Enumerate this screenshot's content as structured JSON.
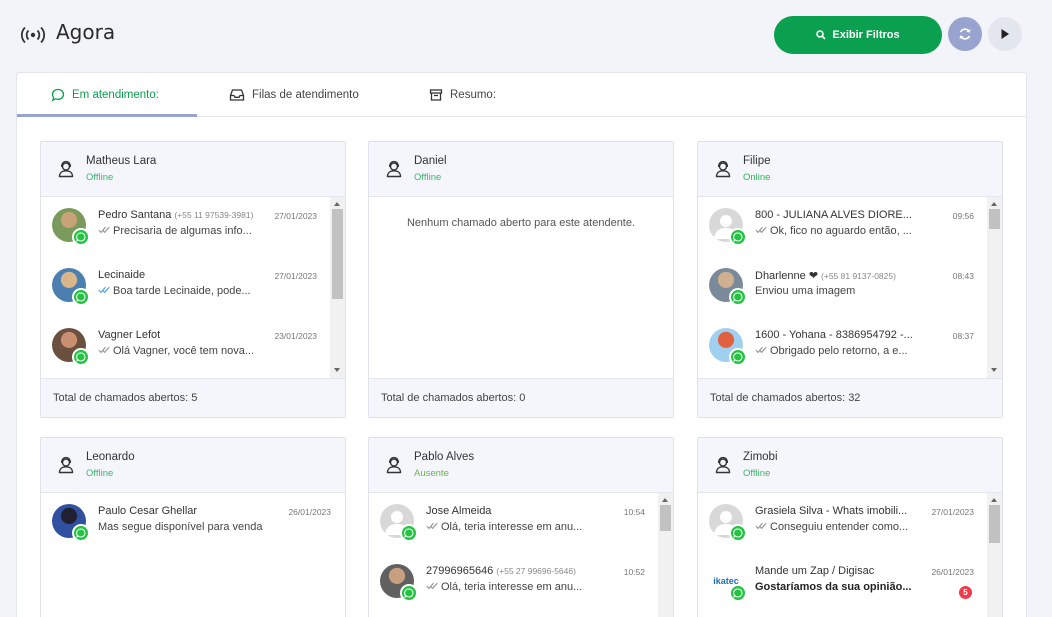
{
  "header": {
    "title": "Agora",
    "filter_button": "Exibir Filtros"
  },
  "tabs": [
    {
      "label": "Em atendimento:"
    },
    {
      "label": "Filas de atendimento"
    },
    {
      "label": "Resumo:"
    }
  ],
  "colors": {
    "accent": "#0aa04f",
    "offline": "#3eb36b",
    "online": "#2fb25a",
    "away": "#6ab04c",
    "whatsapp": "#25c343",
    "unread": "#ef3b4c"
  },
  "agents": [
    {
      "name": "Matheus Lara",
      "status": "Offline",
      "total": "Total de chamados abertos: 5",
      "chats": [
        {
          "name": "Pedro Santana",
          "phone": "(+55 11 97539-3981)",
          "date": "27/01/2023",
          "message": "Precisaria de algumas info...",
          "check": "grey",
          "avatar": "photo"
        },
        {
          "name": "Lecinaide",
          "phone": "",
          "date": "27/01/2023",
          "message": "Boa tarde Lecinaide, pode...",
          "check": "blue",
          "avatar": "photo"
        },
        {
          "name": "Vagner Lefot",
          "phone": "",
          "date": "23/01/2023",
          "message": "Olá Vagner, você tem nova...",
          "check": "grey",
          "avatar": "photo"
        }
      ]
    },
    {
      "name": "Daniel",
      "status": "Offline",
      "total": "Total de chamados abertos: 0",
      "empty": "Nenhum chamado aberto para este atendente.",
      "chats": []
    },
    {
      "name": "Filipe",
      "status": "Online",
      "total": "Total de chamados abertos: 32",
      "chats": [
        {
          "name": "800 - JULIANA ALVES DIORE...",
          "phone": "",
          "date": "09:56",
          "message": "Ok, fico no aguardo então, ...",
          "check": "grey",
          "avatar": "default"
        },
        {
          "name": "Dharlenne ❤",
          "phone": "(+55 81 9137-0825)",
          "date": "08:43",
          "message": "Enviou uma imagem",
          "check": "",
          "avatar": "photo"
        },
        {
          "name": "1600 - Yohana - 8386954792 -...",
          "phone": "",
          "date": "08:37",
          "message": "Obrigado pelo retorno, a e...",
          "check": "grey",
          "avatar": "photo"
        }
      ]
    },
    {
      "name": "Leonardo",
      "status": "Offline",
      "total": "",
      "chats": [
        {
          "name": "Paulo Cesar Ghellar",
          "phone": "",
          "date": "26/01/2023",
          "message": "Mas segue disponível para venda",
          "check": "",
          "avatar": "photo"
        }
      ]
    },
    {
      "name": "Pablo Alves",
      "status": "Ausente",
      "total": "",
      "chats": [
        {
          "name": "Jose Almeida",
          "phone": "",
          "date": "10:54",
          "message": "Olá, teria interesse em anu...",
          "check": "grey",
          "avatar": "default"
        },
        {
          "name": "27996965646",
          "phone": "(+55 27 99696-5646)",
          "date": "10:52",
          "message": "Olá, teria interesse em anu...",
          "check": "grey",
          "avatar": "photo"
        }
      ]
    },
    {
      "name": "Zimobi",
      "status": "Offline",
      "total": "",
      "chats": [
        {
          "name": "Grasiela Silva - Whats imobili...",
          "phone": "",
          "date": "27/01/2023",
          "message": "Conseguiu entender como...",
          "check": "grey",
          "avatar": "default"
        },
        {
          "name": "Mande um Zap / Digisac",
          "phone": "",
          "date": "26/01/2023",
          "message": "Gostaríamos da sua opinião...",
          "check": "",
          "avatar": "logo",
          "logo_text": "ikatec",
          "unread": "5"
        }
      ]
    }
  ]
}
